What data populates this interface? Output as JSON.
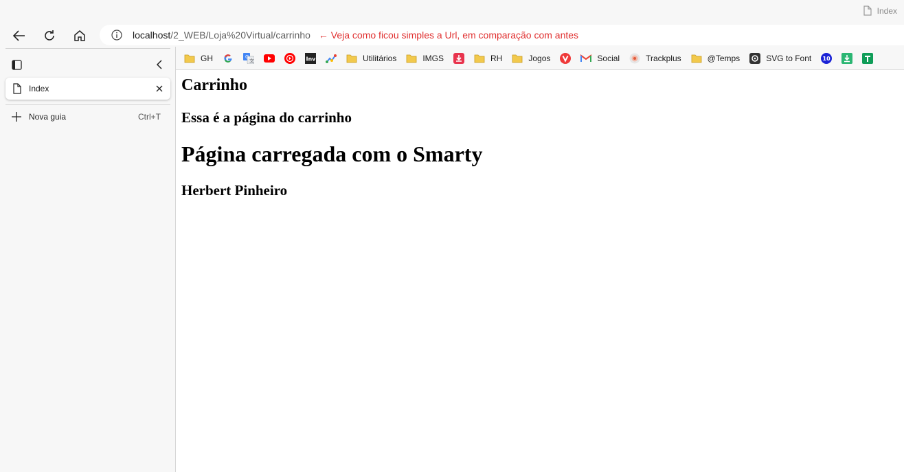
{
  "window": {
    "tab_title": "Index"
  },
  "navbar": {
    "url_host": "localhost",
    "url_path": "/2_WEB/Loja%20Virtual/carrinho",
    "annotation": "← Veja como ficou simples a Url, em comparação com antes"
  },
  "sidebar": {
    "tabs": [
      {
        "label": "Index"
      }
    ],
    "new_tab_label": "Nova guia",
    "new_tab_shortcut": "Ctrl+T"
  },
  "bookmarks": [
    {
      "label": "GH",
      "icon": "folder-icon"
    },
    {
      "label": "",
      "icon": "google-icon"
    },
    {
      "label": "",
      "icon": "translate-icon"
    },
    {
      "label": "",
      "icon": "youtube-icon"
    },
    {
      "label": "",
      "icon": "youtube-music-icon"
    },
    {
      "label": "",
      "icon": "inv-icon"
    },
    {
      "label": "",
      "icon": "analytics-icon"
    },
    {
      "label": "Utilitários",
      "icon": "folder-icon"
    },
    {
      "label": "IMGS",
      "icon": "folder-icon"
    },
    {
      "label": "",
      "icon": "download-red-icon"
    },
    {
      "label": "RH",
      "icon": "folder-icon"
    },
    {
      "label": "Jogos",
      "icon": "folder-icon"
    },
    {
      "label": "",
      "icon": "vivaldi-icon"
    },
    {
      "label": "Social",
      "icon": "gmail-icon"
    },
    {
      "label": "Trackplus",
      "icon": "trackplus-icon"
    },
    {
      "label": "@Temps",
      "icon": "folder-icon"
    },
    {
      "label": "SVG to Font",
      "icon": "svg-font-icon"
    },
    {
      "label": "",
      "icon": "ten-icon"
    },
    {
      "label": "",
      "icon": "download-green-icon"
    },
    {
      "label": "",
      "icon": "sheets-icon"
    }
  ],
  "page": {
    "heading1": "Carrinho",
    "heading2": "Essa é a página do carrinho",
    "heading3": "Página carregada com o Smarty",
    "heading4": "Herbert Pinheiro"
  },
  "colors": {
    "annotation": "#e03030",
    "folder": "#f2c94c",
    "chrome_bg": "#f7f7f7"
  }
}
